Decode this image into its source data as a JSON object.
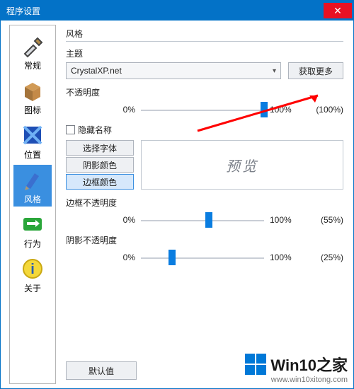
{
  "title": "程序设置",
  "sidebar": {
    "items": [
      {
        "label": "常规"
      },
      {
        "label": "图标"
      },
      {
        "label": "位置"
      },
      {
        "label": "风格"
      },
      {
        "label": "行为"
      },
      {
        "label": "关于"
      }
    ]
  },
  "main": {
    "section": "风格",
    "theme_label": "主题",
    "theme_value": "CrystalXP.net",
    "get_more": "获取更多",
    "opacity": {
      "label": "不透明度",
      "lo": "0%",
      "hi": "100%",
      "val": "(100%)"
    },
    "hide_name_label": "隐藏名称",
    "font_btn": "选择字体",
    "shadow_color_btn": "阴影颜色",
    "border_color_btn": "边框颜色",
    "preview": "预览",
    "border_opacity": {
      "label": "边框不透明度",
      "lo": "0%",
      "hi": "100%",
      "val": "(55%)"
    },
    "shadow_opacity": {
      "label": "阴影不透明度",
      "lo": "0%",
      "hi": "100%",
      "val": "(25%)"
    },
    "default_btn": "默认值"
  },
  "watermark": {
    "text": "Win10之家",
    "url": "www.win10xitong.com"
  }
}
